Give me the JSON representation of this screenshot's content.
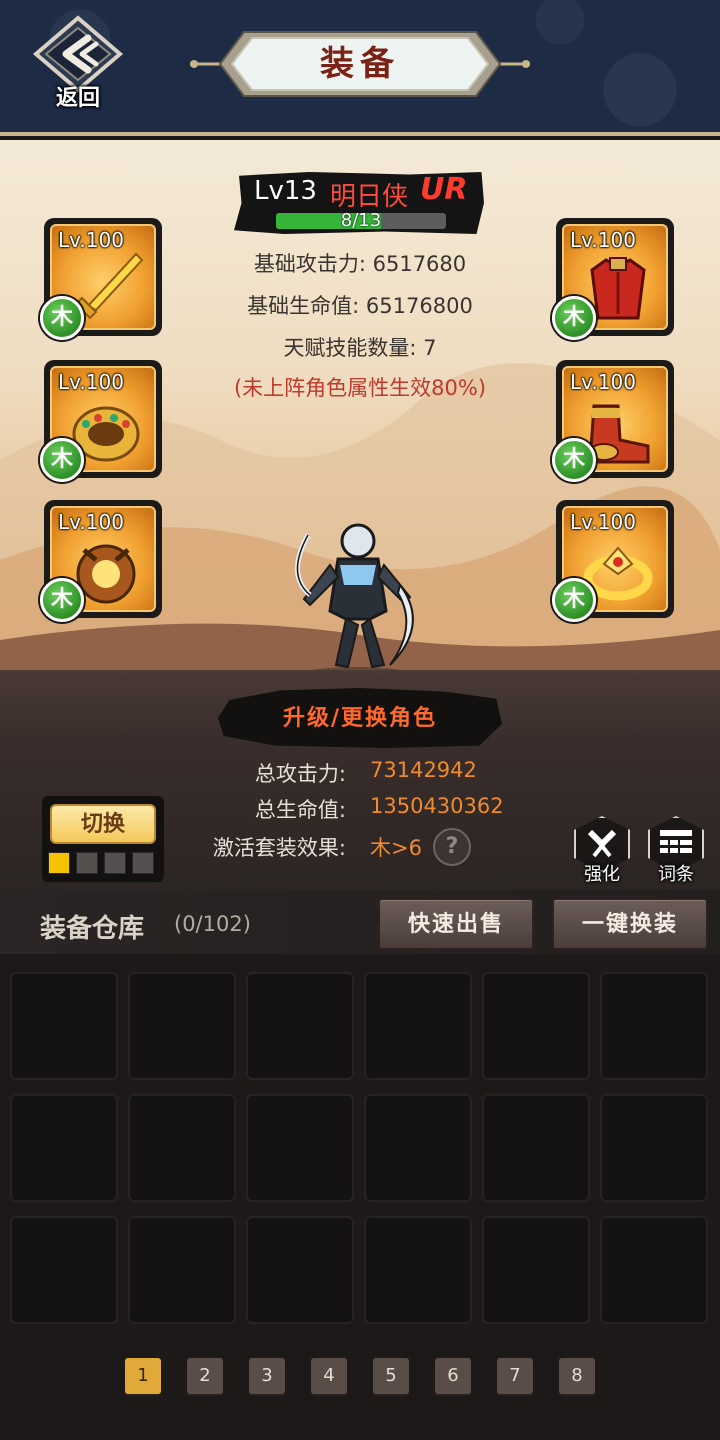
{
  "header": {
    "back_label": "返回",
    "title": "装备"
  },
  "character": {
    "level": "Lv13",
    "name": "明日侠",
    "rank": "UR",
    "xp_text": "8/13",
    "xp_fraction": 0.615
  },
  "base_stats": {
    "attack": "基础攻击力: 6517680",
    "hp": "基础生命值: 65176800",
    "talent": "天赋技能数量: 7",
    "note": "(未上阵角色属性生效80%)"
  },
  "equipment": [
    {
      "level": "Lv.100",
      "element": "木",
      "icon": "golden-sword-icon"
    },
    {
      "level": "Lv.100",
      "element": "木",
      "icon": "jeweled-bracer-icon"
    },
    {
      "level": "Lv.100",
      "element": "木",
      "icon": "amulet-lantern-icon"
    },
    {
      "level": "Lv.100",
      "element": "木",
      "icon": "red-armor-icon"
    },
    {
      "level": "Lv.100",
      "element": "木",
      "icon": "boots-icon"
    },
    {
      "level": "Lv.100",
      "element": "木",
      "icon": "gold-ring-icon"
    }
  ],
  "upgrade_button": "升级/更换角色",
  "totals": {
    "attack_label": "总攻击力:",
    "attack_value": "73142942",
    "hp_label": "总生命值:",
    "hp_value": "1350430362",
    "set_label": "激活套装效果:",
    "set_value": "木>6",
    "help": "?"
  },
  "switch": {
    "label": "切换",
    "pages": 4,
    "active_page": 1
  },
  "tools": {
    "enhance_label": "强化",
    "affix_label": "词条"
  },
  "warehouse": {
    "title": "装备仓库",
    "count": "(0/102)",
    "quick_sell": "快速出售",
    "one_click_equip": "一键换装",
    "slots": 18
  },
  "pagination": {
    "pages": [
      "1",
      "2",
      "3",
      "4",
      "5",
      "6",
      "7",
      "8"
    ],
    "active": "1"
  },
  "colors": {
    "header_bg": "#1d2b45",
    "accent_gold": "#e0a93a",
    "value_orange": "#f08a2e",
    "element_green": "#2e8f27",
    "rank_red": "#ff3b2e"
  }
}
